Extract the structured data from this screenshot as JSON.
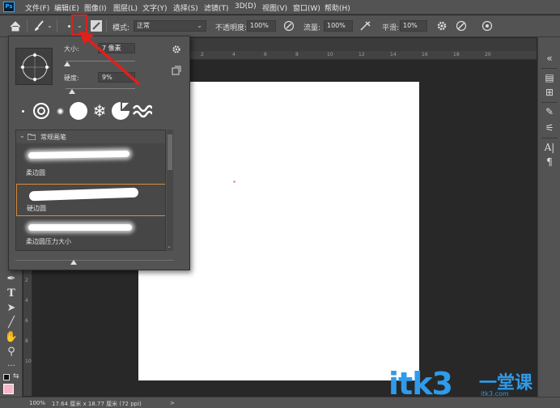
{
  "menubar": {
    "logo": "Ps",
    "items": [
      {
        "label": "文件(F)"
      },
      {
        "label": "编辑(E)"
      },
      {
        "label": "图像(I)"
      },
      {
        "label": "图层(L)"
      },
      {
        "label": "文字(Y)"
      },
      {
        "label": "选择(S)"
      },
      {
        "label": "滤镜(T)"
      },
      {
        "label": "3D(D)"
      },
      {
        "label": "视图(V)"
      },
      {
        "label": "窗口(W)"
      },
      {
        "label": "帮助(H)"
      }
    ]
  },
  "options": {
    "home_icon": "home-icon",
    "tool_icon": "brush-icon",
    "mode_label": "模式:",
    "mode_value": "正常",
    "opacity_label": "不透明度:",
    "opacity_value": "100%",
    "flow_label": "流量:",
    "flow_value": "100%",
    "smooth_label": "平滑:",
    "smooth_value": "10%"
  },
  "brush_picker": {
    "size_label": "大小:",
    "size_value": "7 像素",
    "hardness_label": "硬度:",
    "hardness_value": "9%",
    "size_slider_level": 0.02,
    "hardness_slider_level": 0.09,
    "group_name": "常规画笔",
    "presets": [
      {
        "name": "柔边圆",
        "selected": false
      },
      {
        "name": "硬边圆",
        "selected": true
      },
      {
        "name": "柔边圆压力大小",
        "selected": false
      }
    ]
  },
  "status": {
    "zoom": "100%",
    "doc_info": "17.64 厘米 x 18.77 厘米 (72 ppi)",
    "arrow": ">"
  },
  "rulers": {
    "top": [
      "2",
      "4",
      "6",
      "8",
      "10",
      "12",
      "14",
      "16",
      "18",
      "20"
    ],
    "left": [
      "2",
      "4",
      "6",
      "8",
      "10",
      "12",
      "14",
      "16",
      "18"
    ]
  },
  "colors": {
    "annotation": "#e0201a",
    "foreground": "#f6b8c8",
    "watermark": "#2f9bea"
  },
  "watermark": {
    "text": "itk3",
    "cn_text": "一堂课",
    "sub_text": "itk3.com"
  }
}
